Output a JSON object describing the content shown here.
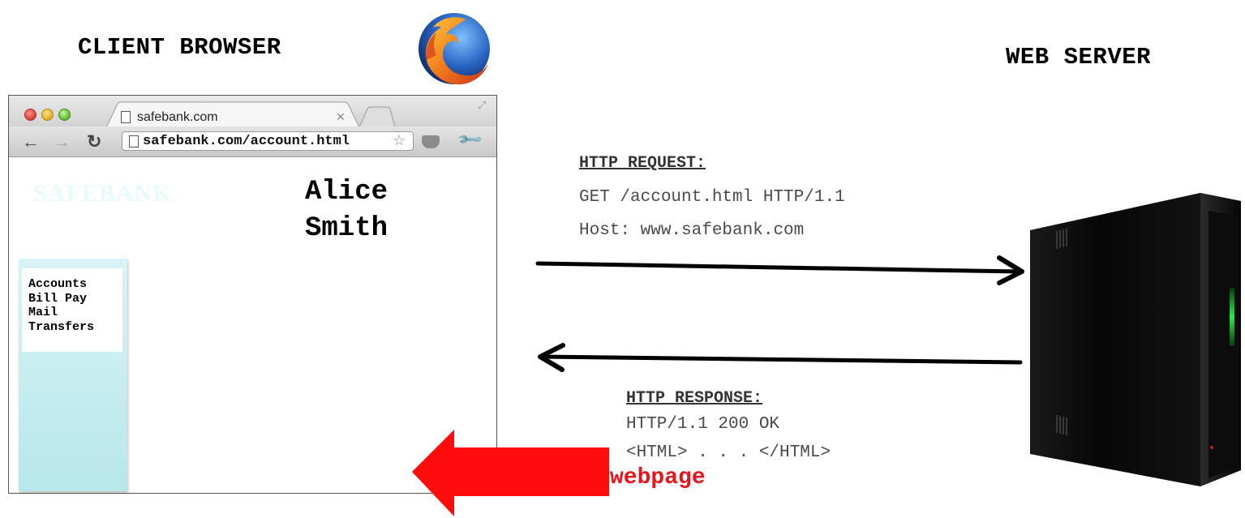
{
  "titles": {
    "client": "CLIENT BROWSER",
    "server": "WEB SERVER"
  },
  "browser": {
    "tab_title": "safebank.com",
    "url": "safebank.com/account.html",
    "page": {
      "logo": "SAFEBANK",
      "user_first": "Alice",
      "user_last": "Smith",
      "menu": [
        "Accounts",
        "Bill Pay",
        "Mail",
        "Transfers"
      ]
    }
  },
  "request": {
    "heading": "HTTP REQUEST:",
    "lines": [
      "GET /account.html HTTP/1.1",
      "Host: www.safebank.com"
    ]
  },
  "response": {
    "heading": "HTTP RESPONSE:",
    "lines": [
      "HTTP/1.1 200 OK",
      "<HTML> . . . </HTML>"
    ]
  },
  "webpage_label": "webpage",
  "icons": [
    "firefox-logo-icon",
    "server-icon",
    "document-icon",
    "star-icon",
    "pocket-icon",
    "wrench-icon"
  ],
  "colors": {
    "arrow_red": "#e8141c",
    "sidebar": "#b7e7ec",
    "server_light": "#2ee84a"
  }
}
